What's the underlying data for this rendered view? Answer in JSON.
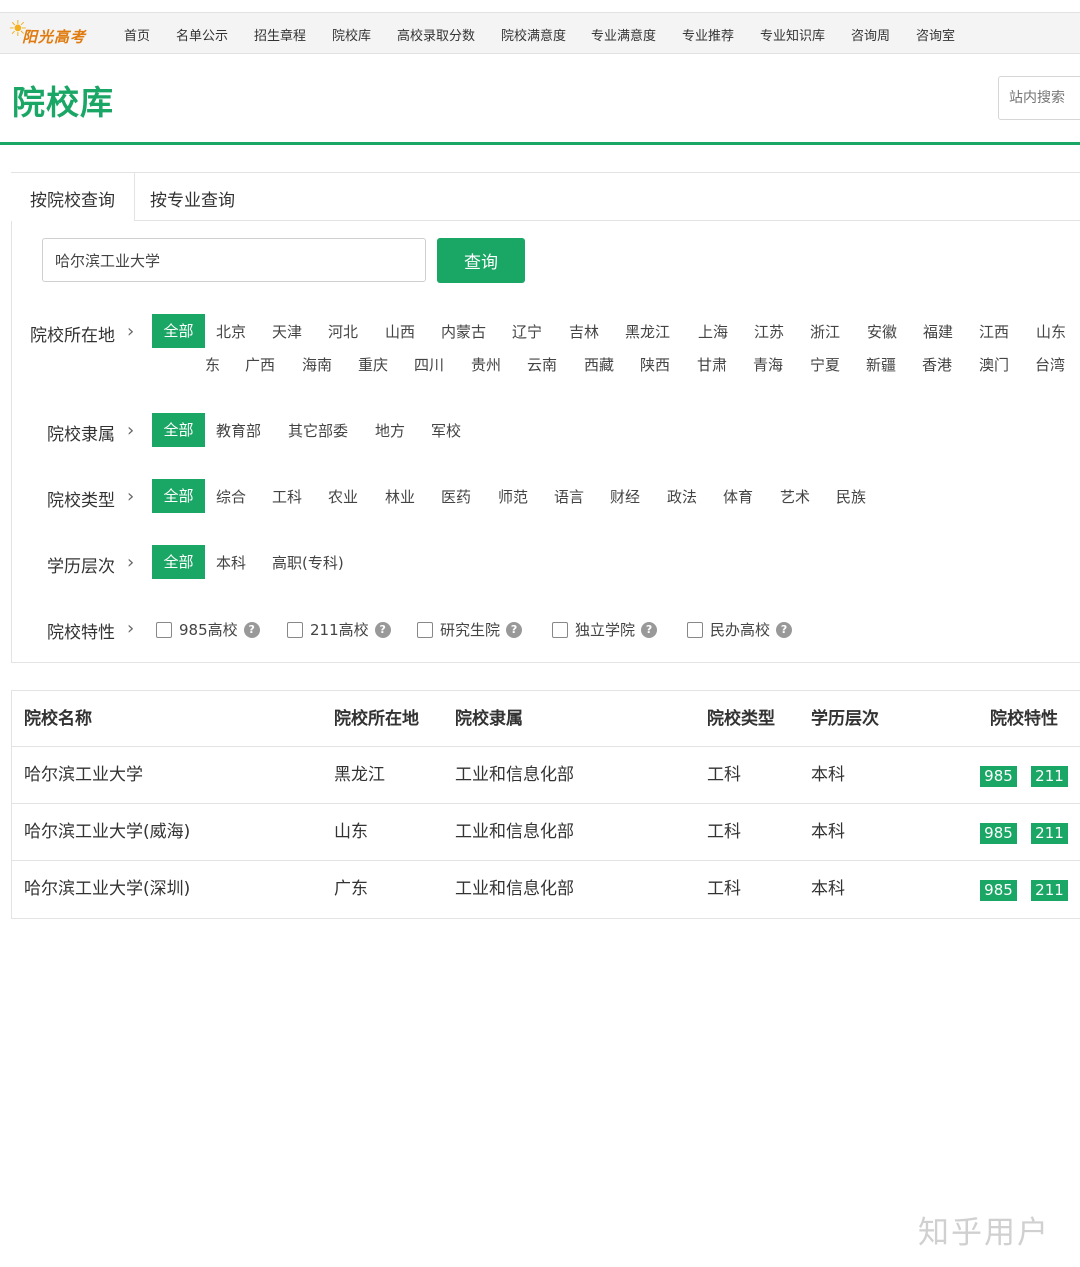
{
  "logo": {
    "text": "阳光高考"
  },
  "nav": [
    "首页",
    "名单公示",
    "招生章程",
    "院校库",
    "高校录取分数",
    "院校满意度",
    "专业满意度",
    "专业推荐",
    "专业知识库",
    "咨询周",
    "咨询室"
  ],
  "header": {
    "title": "院校库",
    "search_placeholder": "站内搜索"
  },
  "tabs": [
    "按院校查询",
    "按专业查询"
  ],
  "query": {
    "value": "哈尔滨工业大学",
    "button": "查询"
  },
  "filters": {
    "location": {
      "label": "院校所在地",
      "row1": [
        "全部",
        "北京",
        "天津",
        "河北",
        "山西",
        "内蒙古",
        "辽宁",
        "吉林",
        "黑龙江",
        "上海",
        "江苏",
        "浙江",
        "安徽",
        "福建",
        "江西",
        "山东"
      ],
      "row2": [
        "东",
        "广西",
        "海南",
        "重庆",
        "四川",
        "贵州",
        "云南",
        "西藏",
        "陕西",
        "甘肃",
        "青海",
        "宁夏",
        "新疆",
        "香港",
        "澳门",
        "台湾"
      ]
    },
    "affiliation": {
      "label": "院校隶属",
      "options": [
        "全部",
        "教育部",
        "其它部委",
        "地方",
        "军校"
      ]
    },
    "type": {
      "label": "院校类型",
      "options": [
        "全部",
        "综合",
        "工科",
        "农业",
        "林业",
        "医药",
        "师范",
        "语言",
        "财经",
        "政法",
        "体育",
        "艺术",
        "民族"
      ]
    },
    "level": {
      "label": "学历层次",
      "options": [
        "全部",
        "本科",
        "高职(专科)"
      ]
    },
    "feature": {
      "label": "院校特性",
      "options": [
        "985高校",
        "211高校",
        "研究生院",
        "独立学院",
        "民办高校"
      ],
      "help": "?"
    }
  },
  "table": {
    "headers": [
      "院校名称",
      "院校所在地",
      "院校隶属",
      "院校类型",
      "学历层次",
      "院校特性"
    ],
    "rows": [
      [
        "哈尔滨工业大学",
        "黑龙江",
        "工业和信息化部",
        "工科",
        "本科",
        "985",
        "211"
      ],
      [
        "哈尔滨工业大学(威海)",
        "山东",
        "工业和信息化部",
        "工科",
        "本科",
        "985",
        "211"
      ],
      [
        "哈尔滨工业大学(深圳)",
        "广东",
        "工业和信息化部",
        "工科",
        "本科",
        "985",
        "211"
      ]
    ]
  },
  "watermark": "知乎用户",
  "colors": {
    "accent": "#1aa664",
    "logo": "#e07b10"
  }
}
